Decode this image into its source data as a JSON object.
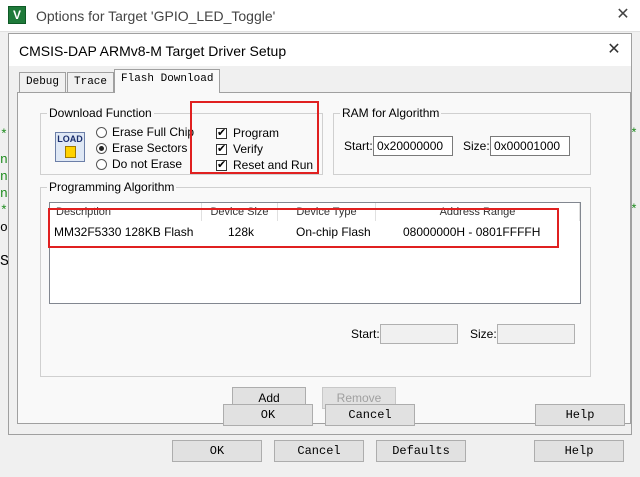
{
  "outer_window": {
    "logo": "V",
    "title": "Options for Target 'GPIO_LED_Toggle'",
    "close": "✕",
    "buttons": {
      "ok": "OK",
      "cancel": "Cancel",
      "defaults": "Defaults",
      "help": "Help"
    }
  },
  "background_editor": {
    "left_lines": [
      "*",
      "n",
      "n",
      "n",
      "*",
      "o",
      "",
      "S"
    ],
    "right_lines": [
      "*",
      "",
      "",
      "",
      "*"
    ]
  },
  "dialog": {
    "title": "CMSIS-DAP ARMv8-M Target Driver Setup",
    "close": "✕",
    "tabs": [
      "Debug",
      "Trace",
      "Flash Download"
    ],
    "active_tab": "Flash Download",
    "download_function": {
      "label": "Download Function",
      "icon_text": "LOAD",
      "erase_options": [
        "Erase Full Chip",
        "Erase Sectors",
        "Do not Erase"
      ],
      "selected_erase": "Erase Sectors",
      "checks": [
        {
          "label": "Program",
          "checked": true
        },
        {
          "label": "Verify",
          "checked": true
        },
        {
          "label": "Reset and Run",
          "checked": true
        }
      ]
    },
    "ram_for_algorithm": {
      "label": "RAM for Algorithm",
      "start_label": "Start:",
      "start_value": "0x20000000",
      "size_label": "Size:",
      "size_value": "0x00001000"
    },
    "programming_algorithm": {
      "label": "Programming Algorithm",
      "columns": [
        "Description",
        "Device Size",
        "Device Type",
        "Address Range"
      ],
      "rows": [
        {
          "description": "MM32F5330 128KB Flash",
          "size": "128k",
          "type": "On-chip Flash",
          "range": "08000000H - 0801FFFFH"
        }
      ],
      "start_label": "Start:",
      "start_value": "",
      "size_label": "Size:",
      "size_value": ""
    },
    "add_label": "Add",
    "remove_label": "Remove",
    "buttons": {
      "ok": "OK",
      "cancel": "Cancel",
      "help": "Help"
    }
  },
  "colors": {
    "highlight": "#e02020",
    "code_green": "#1a8a1a"
  }
}
